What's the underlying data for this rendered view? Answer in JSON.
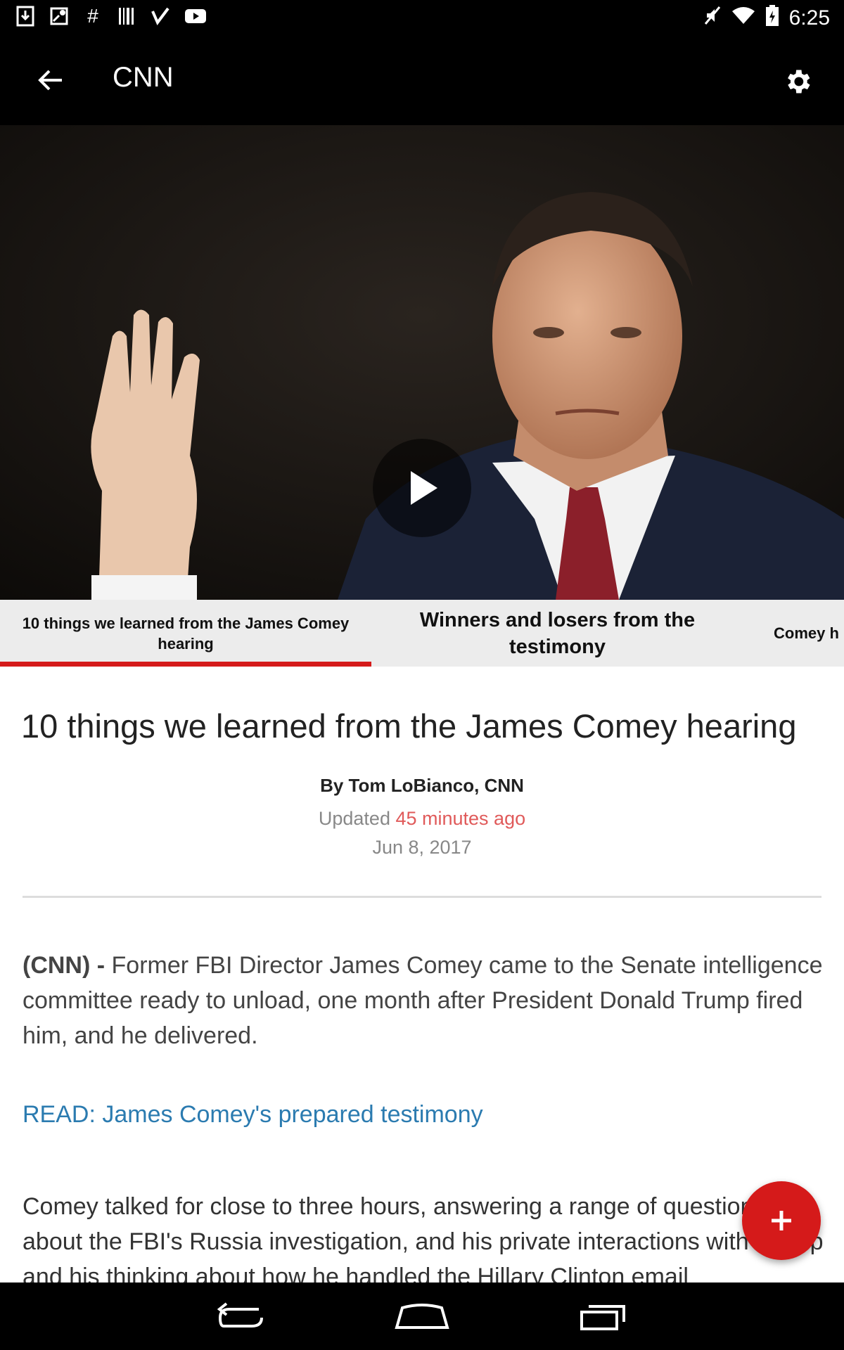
{
  "status_bar": {
    "time": "6:25",
    "left_icons": [
      "download-icon",
      "maps-icon",
      "hashtag-icon",
      "barcode-icon",
      "checkmark-icon",
      "youtube-icon"
    ],
    "right_icons": [
      "mute-icon",
      "wifi-icon",
      "battery-icon"
    ]
  },
  "app_bar": {
    "title": "CNN",
    "back_icon": "arrow-back-icon",
    "settings_icon": "gear-icon"
  },
  "hero": {
    "play_icon": "play-icon"
  },
  "tabs": [
    {
      "label": "10 things we learned from the James Comey hearing",
      "selected": true
    },
    {
      "label": "Winners and losers from the testimony",
      "selected": false
    },
    {
      "label": "Comey h",
      "selected": false
    }
  ],
  "article": {
    "headline": "10 things we learned from the James Comey hearing",
    "byline": "By Tom LoBianco, CNN",
    "updated_prefix": "Updated",
    "updated_ago": "45 minutes ago",
    "date": "Jun 8, 2017",
    "para1_lead": "(CNN) -",
    "para1_text": "Former FBI Director James Comey came to the Senate intelligence committee ready to unload, one month after President Donald Trump fired him, and he delivered.",
    "read_link": "READ: James Comey's prepared testimony",
    "para2_text": "Comey talked for close to three hours, answering a range of questions about the FBI's Russia investigation,  and his private interactions with Trump and his thinking about how he handled the Hillary Clinton email"
  },
  "fab": {
    "icon": "plus-icon",
    "label": "+"
  },
  "nav_bar": {
    "icons": [
      "back-nav-icon",
      "home-nav-icon",
      "recents-nav-icon"
    ]
  },
  "colors": {
    "accent_red": "#d51a1a",
    "link_blue": "#2b7bb0",
    "updated_red": "#e05a5a"
  }
}
